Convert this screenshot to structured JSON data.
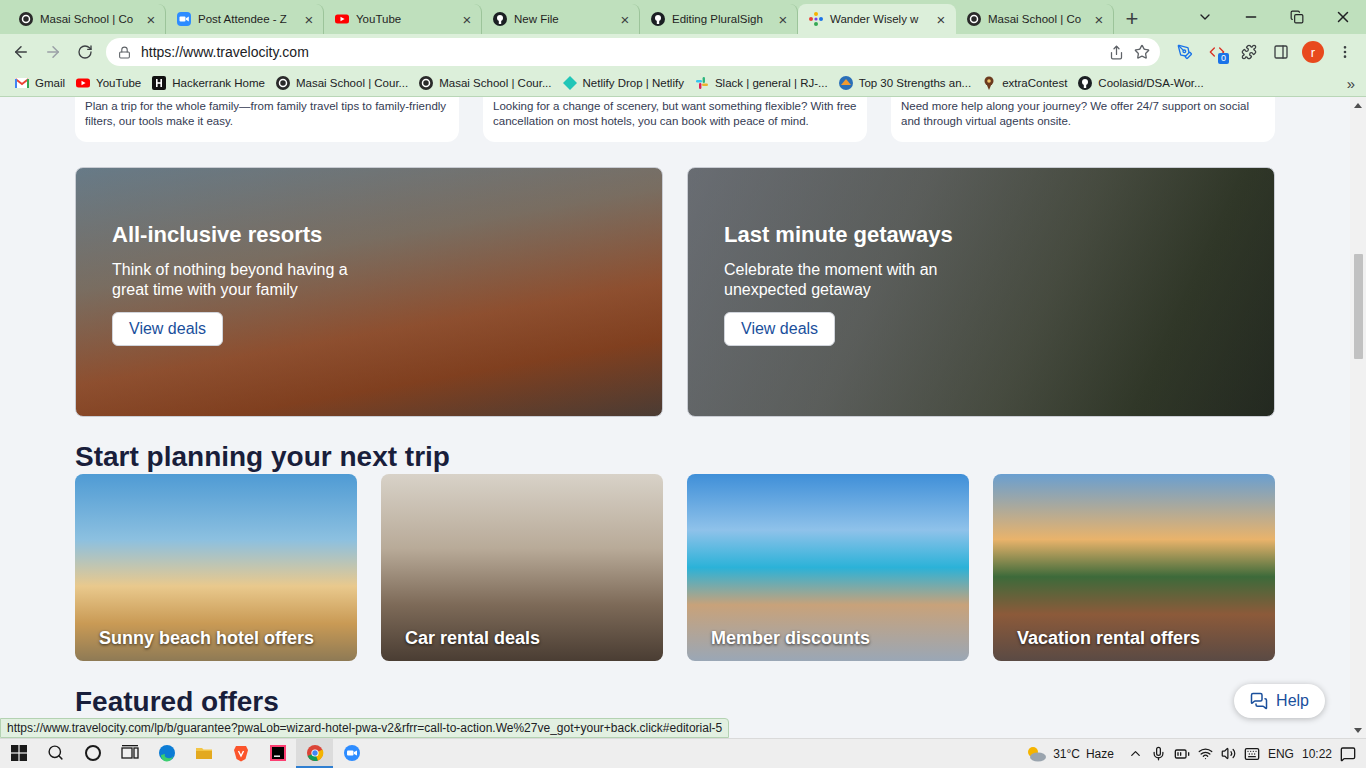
{
  "browser": {
    "tabs": [
      {
        "label": "Masai School | Co",
        "kind": "masai",
        "selected": false
      },
      {
        "label": "Post Attendee - Z",
        "kind": "zoom",
        "selected": false
      },
      {
        "label": "YouTube",
        "kind": "youtube",
        "selected": false
      },
      {
        "label": "New File",
        "kind": "github",
        "selected": false
      },
      {
        "label": "Editing PluralSigh",
        "kind": "github",
        "selected": false
      },
      {
        "label": "Wander Wisely w",
        "kind": "travelocity",
        "selected": true
      },
      {
        "label": "Masai School | Co",
        "kind": "masai",
        "selected": false
      }
    ],
    "tab_close": "×",
    "new_tab": "+",
    "url": "https://www.travelocity.com",
    "extension_badge": "0",
    "profile_initial": "r",
    "bookmarks": [
      {
        "label": "Gmail",
        "kind": "gmail"
      },
      {
        "label": "YouTube",
        "kind": "youtube"
      },
      {
        "label": "Hackerrank Home",
        "kind": "hackerrank"
      },
      {
        "label": "Masai School | Cour...",
        "kind": "masai"
      },
      {
        "label": "Masai School | Cour...",
        "kind": "masai"
      },
      {
        "label": "Netlify Drop | Netlify",
        "kind": "netlify"
      },
      {
        "label": "Slack | general | RJ-...",
        "kind": "slack"
      },
      {
        "label": "Top 30 Strengths an...",
        "kind": "strengths"
      },
      {
        "label": "extraContest",
        "kind": "contest"
      },
      {
        "label": "Coolasid/DSA-Wor...",
        "kind": "github"
      }
    ],
    "bookmarks_more": "»"
  },
  "page": {
    "info_cards": [
      {
        "text": "Plan a trip for the whole family—from family travel tips to family-friendly filters, our tools make it easy."
      },
      {
        "text": "Looking for a change of scenery, but want something flexible? With free cancellation on most hotels, you can book with peace of mind."
      },
      {
        "text": "Need more help along your journey? We offer 24/7 support on social and through virtual agents onsite."
      }
    ],
    "hero_cards": [
      {
        "title": "All-inclusive resorts",
        "text": "Think of nothing beyond having a great time with your family",
        "button": "View deals"
      },
      {
        "title": "Last minute getaways",
        "text": "Celebrate the moment with an unexpected getaway",
        "button": "View deals"
      }
    ],
    "planning_heading": "Start planning your next trip",
    "planning_cards": [
      {
        "label": "Sunny beach hotel offers"
      },
      {
        "label": "Car rental deals"
      },
      {
        "label": "Member discounts"
      },
      {
        "label": "Vacation rental offers"
      }
    ],
    "featured_heading": "Featured offers",
    "help_button": "Help"
  },
  "status_url": "https://www.travelocity.com/lp/b/guarantee?pwaLob=wizard-hotel-pwa-v2&rfrr=call-to-action.We%27ve_got+your+back.click#editorial-5",
  "taskbar": {
    "apps": [
      {
        "kind": "edge",
        "active": false
      },
      {
        "kind": "files",
        "active": false
      },
      {
        "kind": "brave",
        "active": false
      },
      {
        "kind": "intellij",
        "active": false
      },
      {
        "kind": "chrome",
        "active": true
      },
      {
        "kind": "zoom",
        "active": false
      }
    ],
    "temperature": "31°C",
    "weather": "Haze",
    "language": "ENG",
    "time": "10:22"
  }
}
